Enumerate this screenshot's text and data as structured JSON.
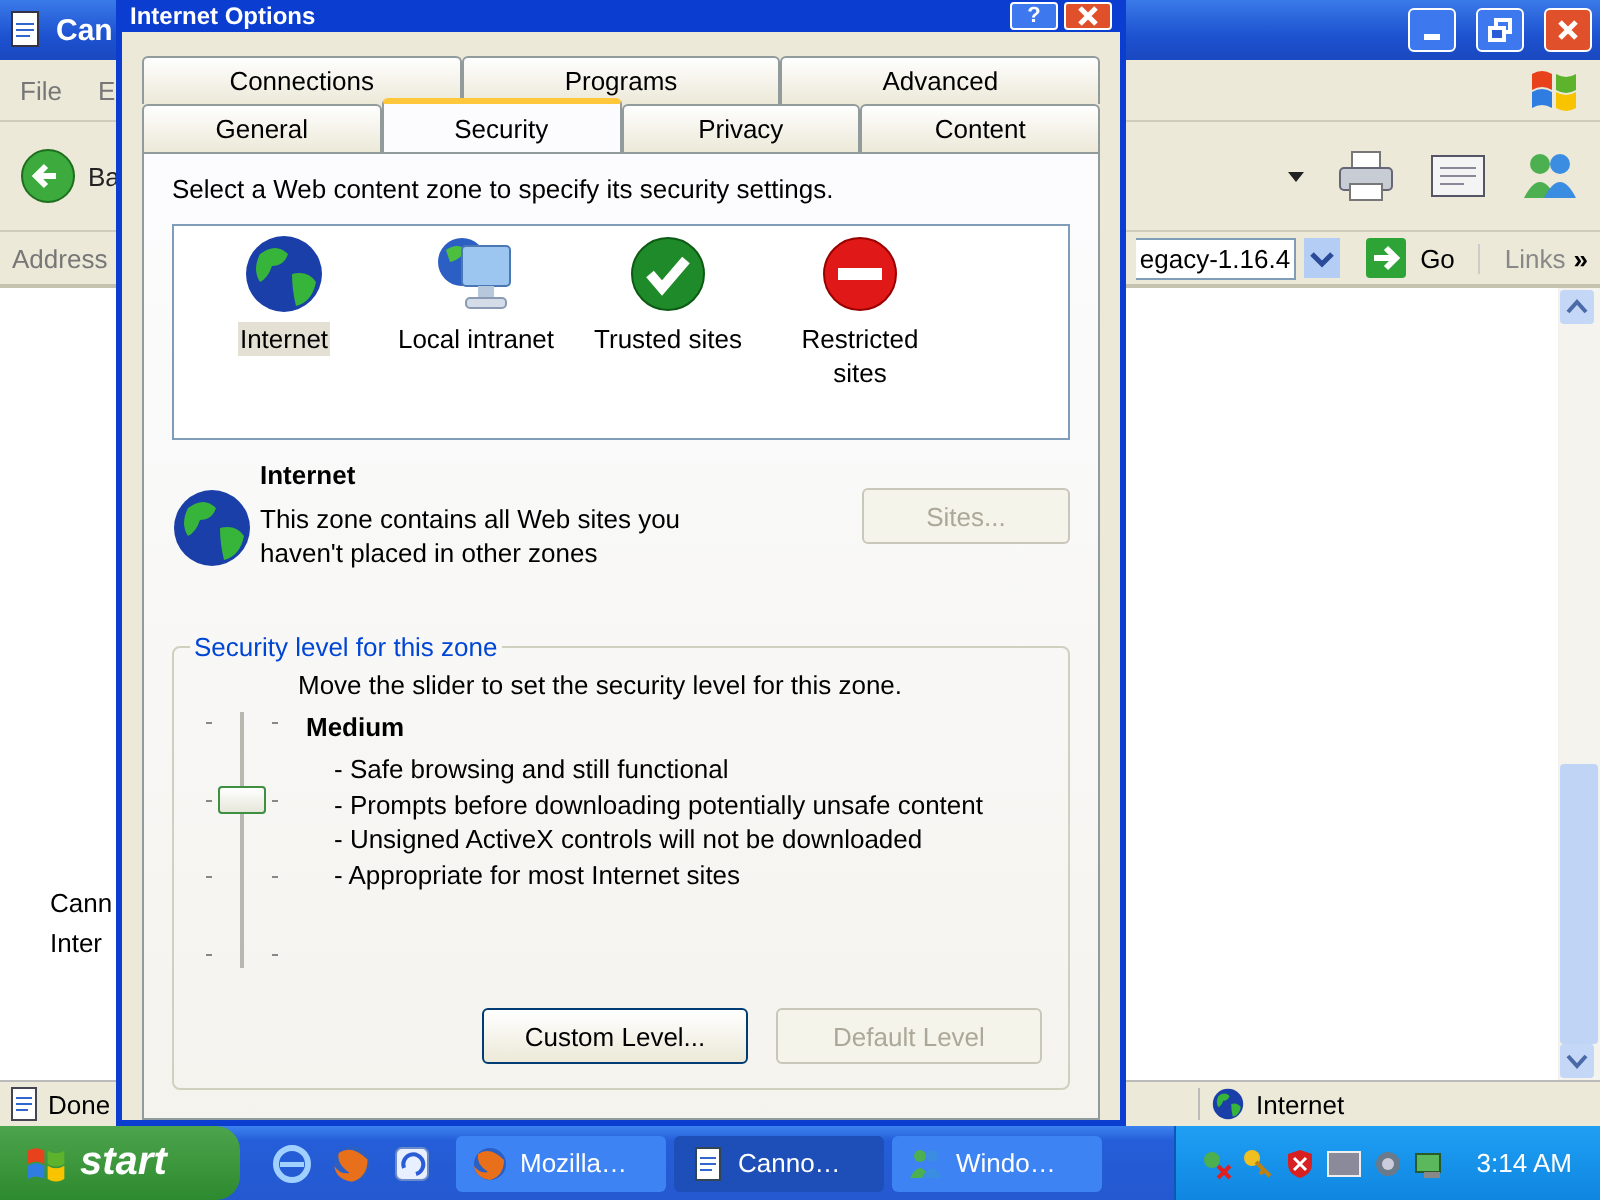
{
  "browser": {
    "title": "Can",
    "menu": [
      "File",
      "E"
    ],
    "back_label": "Ba",
    "address_label": "Address",
    "address_value": "egacy-1.16.4",
    "go_label": "Go",
    "links_label": "Links",
    "chevron": "»",
    "content_lines": [
      "Cann",
      "Inter"
    ],
    "status": "Done",
    "zone": "Internet"
  },
  "dialog": {
    "title": "Internet Options",
    "help": "?",
    "tab_rows": [
      [
        {
          "label": "Connections",
          "selected": false
        },
        {
          "label": "Programs",
          "selected": false
        },
        {
          "label": "Advanced",
          "selected": false
        }
      ],
      [
        {
          "label": "General",
          "selected": false
        },
        {
          "label": "Security",
          "selected": true
        },
        {
          "label": "Privacy",
          "selected": false
        },
        {
          "label": "Content",
          "selected": false
        }
      ]
    ],
    "instruction": "Select a Web content zone to specify its security settings.",
    "zones": [
      {
        "label": "Internet",
        "kind": "globe",
        "selected": true
      },
      {
        "label": "Local intranet",
        "kind": "computer",
        "selected": false
      },
      {
        "label": "Trusted sites",
        "kind": "check",
        "selected": false
      },
      {
        "label": "Restricted sites",
        "kind": "stop",
        "selected": false
      }
    ],
    "zone_name": "Internet",
    "zone_description": "This zone contains all Web sites you haven't placed in other zones",
    "sites_button": {
      "label": "Sites...",
      "disabled": true
    },
    "group_title": "Security level for this zone",
    "slider_hint": "Move the slider to set the security level for this zone.",
    "slider": {
      "level": 0.667
    },
    "level_name": "Medium",
    "bullets": [
      "- Safe browsing and still functional",
      "- Prompts before downloading potentially unsafe content",
      "- Unsigned ActiveX controls will not be downloaded",
      "- Appropriate for most Internet sites"
    ],
    "buttons": [
      {
        "label": "Custom Level...",
        "disabled": false
      },
      {
        "label": "Default Level",
        "disabled": true
      }
    ]
  },
  "taskbar": {
    "start": "start",
    "tasks": [
      {
        "label": "Mozilla…",
        "kind": "firefox",
        "selected": false
      },
      {
        "label": "Canno…",
        "kind": "document",
        "selected": true
      },
      {
        "label": "Windo…",
        "kind": "people",
        "selected": false
      }
    ],
    "clock": "3:14 AM"
  }
}
